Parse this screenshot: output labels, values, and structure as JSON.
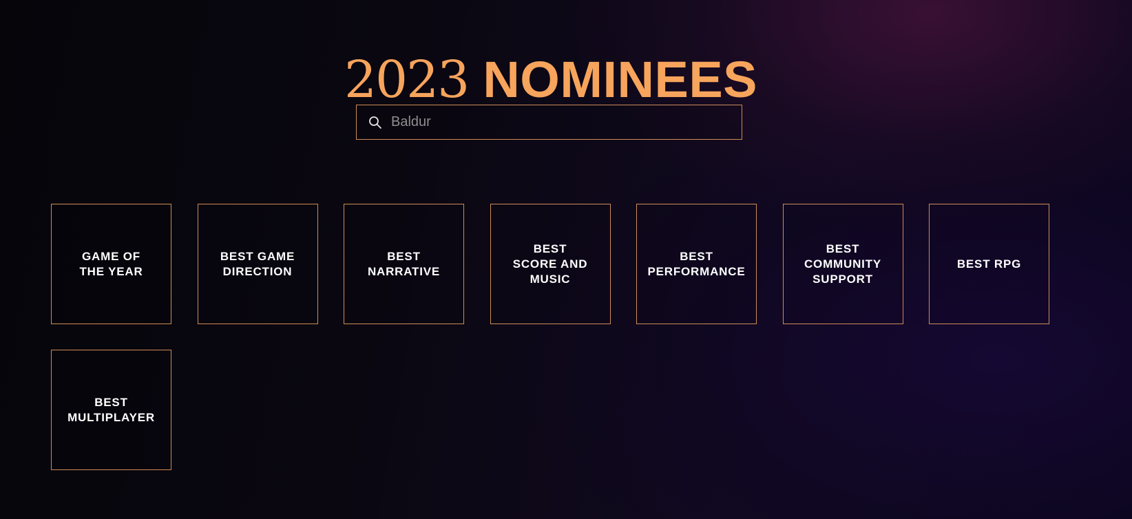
{
  "header": {
    "title_year": "2023",
    "title_word": "NOMINEES"
  },
  "search": {
    "icon": "search-icon",
    "value": "",
    "placeholder": "Baldur"
  },
  "categories": [
    {
      "label": "GAME OF\nTHE YEAR"
    },
    {
      "label": "BEST GAME\nDIRECTION"
    },
    {
      "label": "BEST\nNARRATIVE"
    },
    {
      "label": "BEST\nSCORE AND\nMUSIC"
    },
    {
      "label": "BEST\nPERFORMANCE"
    },
    {
      "label": "BEST\nCOMMUNITY\nSUPPORT"
    },
    {
      "label": "BEST RPG"
    },
    {
      "label": "BEST\nMULTIPLAYER"
    }
  ],
  "colors": {
    "accent": "#f7a45c",
    "border": "#d08d57",
    "text": "#ffffff"
  }
}
